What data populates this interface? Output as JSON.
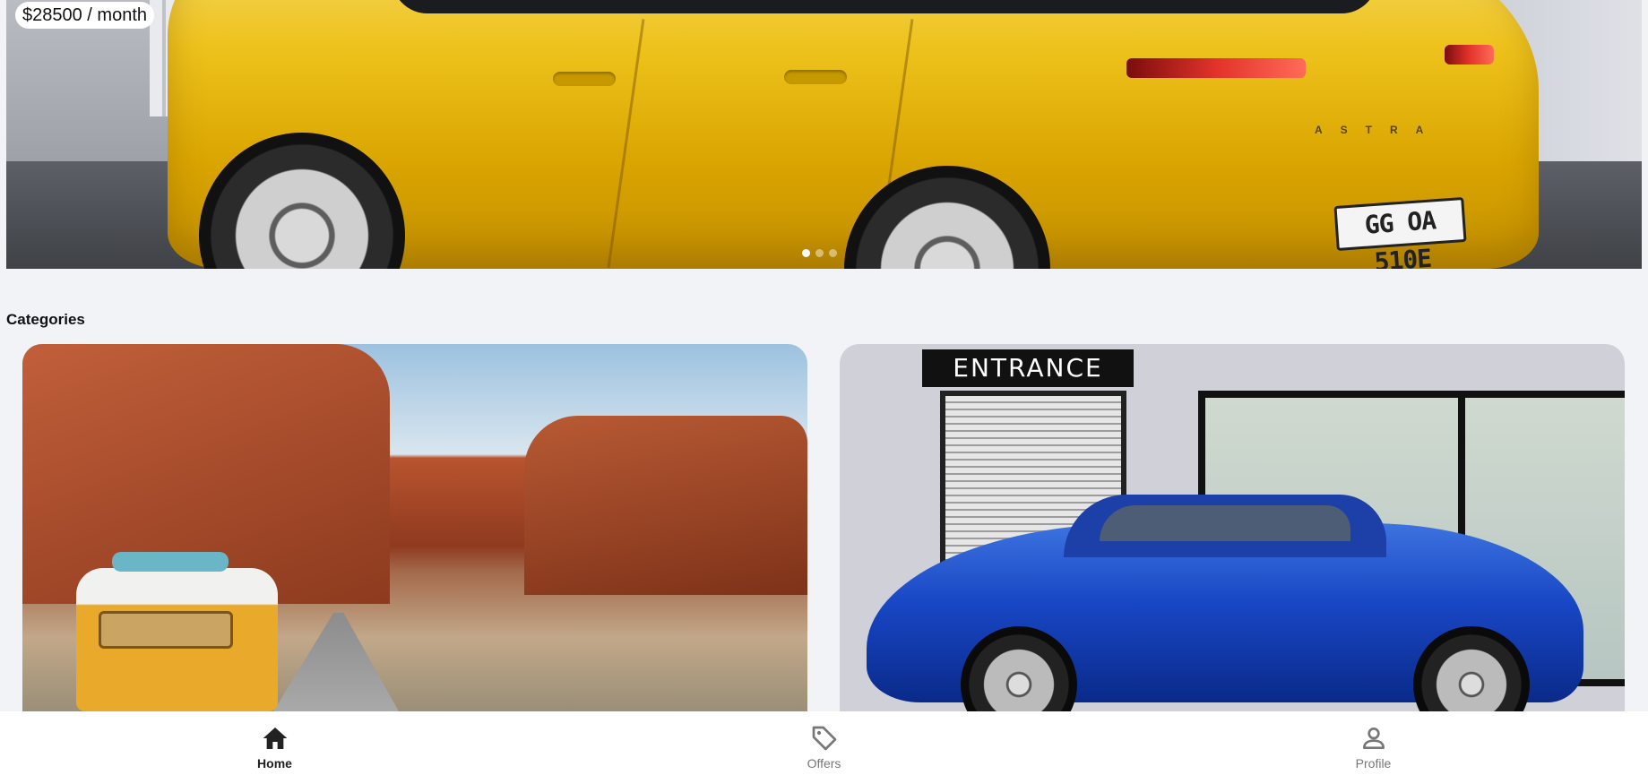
{
  "hero": {
    "price_label": "$28500 / month",
    "plate_text": "GG OA 510E",
    "badge_text": "ASTRA",
    "slides": 3,
    "active_slide": 1
  },
  "categories": {
    "title": "Categories",
    "cards": [
      {
        "alt": "Camper van on desert road"
      },
      {
        "alt": "Blue coupe in front of entrance",
        "sign_text": "ENTRANCE"
      }
    ]
  },
  "bottom_nav": {
    "items": [
      {
        "label": "Home",
        "icon": "home-icon",
        "active": true
      },
      {
        "label": "Offers",
        "icon": "tag-icon",
        "active": false
      },
      {
        "label": "Profile",
        "icon": "person-icon",
        "active": false
      }
    ]
  },
  "colors": {
    "background": "#f2f3f6",
    "nav_active": "#222222",
    "nav_inactive": "#777777"
  }
}
